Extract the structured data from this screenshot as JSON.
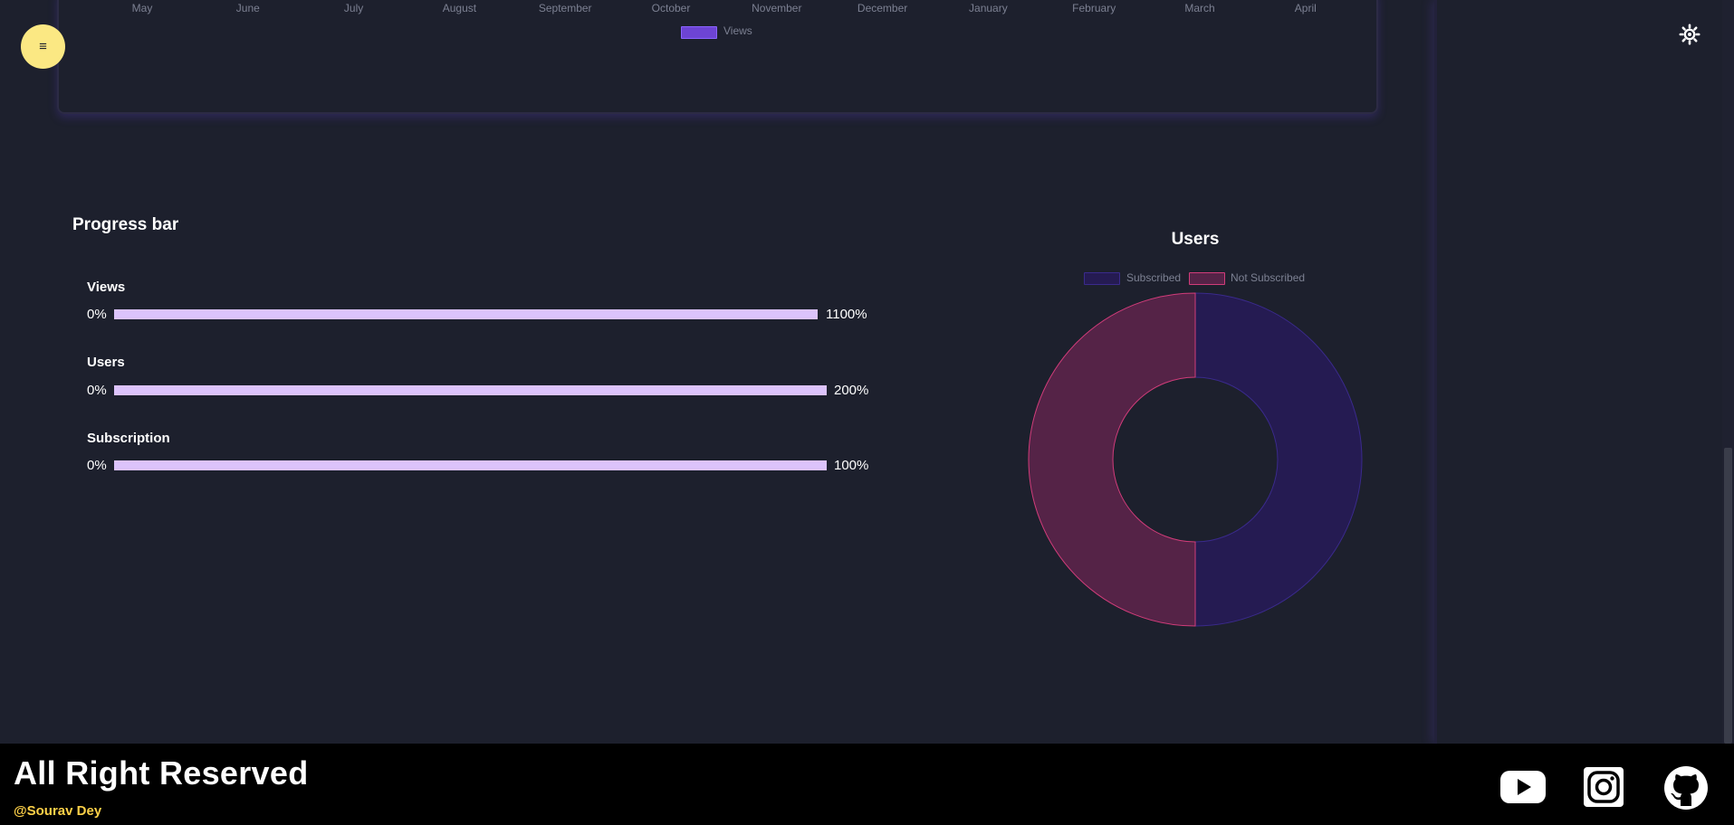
{
  "line_chart": {
    "months": [
      "May",
      "June",
      "July",
      "August",
      "September",
      "October",
      "November",
      "December",
      "January",
      "February",
      "March",
      "April"
    ],
    "legend": {
      "label": "Views",
      "color": "#6d44d3"
    }
  },
  "icons": {
    "menu": "menu-icon",
    "settings": "sun-settings-icon",
    "youtube": "youtube-icon",
    "instagram": "instagram-icon",
    "github": "github-icon"
  },
  "menu_glyph": "≡",
  "progress": {
    "title": "Progress bar",
    "bars": [
      {
        "label": "Views",
        "min": "0%",
        "max": "1100%",
        "fill_fraction": 1.0
      },
      {
        "label": "Users",
        "min": "0%",
        "max": "200%",
        "fill_fraction": 1.0
      },
      {
        "label": "Subscription",
        "min": "0%",
        "max": "100%",
        "fill_fraction": 1.0
      }
    ]
  },
  "chart_data": {
    "type": "pie",
    "title": "Users",
    "labels": [
      "Subscribed",
      "Not Subscribed"
    ],
    "values": [
      1,
      1
    ],
    "colors": {
      "Subscribed": "#251b52",
      "Not Subscribed": "#552347"
    },
    "border_colors": {
      "Subscribed": "#3a2a8c",
      "Not Subscribed": "#d13c7a"
    },
    "legend": "top"
  },
  "footer": {
    "title": "All Right Reserved",
    "credit": "@Sourav Dey"
  },
  "colors": {
    "background": "#1d202d",
    "accent_yellow": "#fbe883",
    "progress_fill": "#dcc3fb",
    "credit": "#fdd048"
  }
}
